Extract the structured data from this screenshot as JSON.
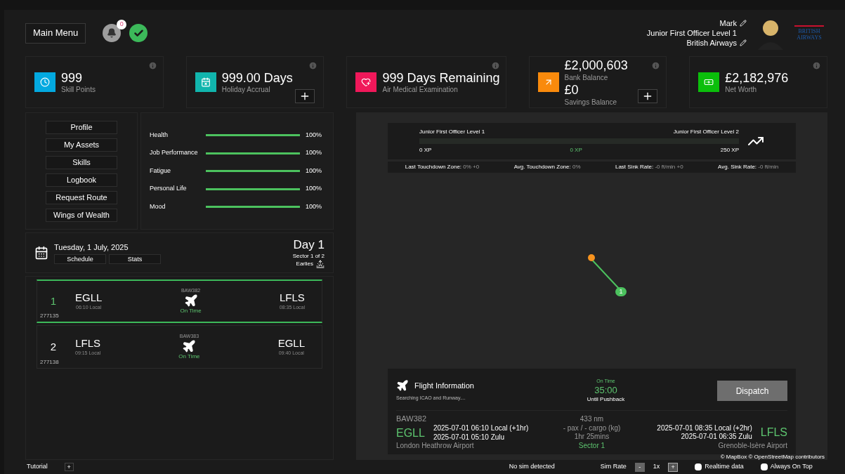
{
  "header": {
    "main_menu": "Main Menu",
    "notifications": "0",
    "status_ok": true,
    "user": {
      "name": "Mark",
      "rank": "Junior First Officer Level 1",
      "airline": "British Airways"
    },
    "logo_text": "BRITISH AIRWAYS"
  },
  "stat_cards": [
    {
      "kind": "clock",
      "color": "#03a9e0",
      "value": "999",
      "label": "Skill Points",
      "add": false
    },
    {
      "kind": "calendar",
      "color": "#11b5ad",
      "value": "999.00 Days",
      "label": "Holiday Accrual",
      "add": true
    },
    {
      "kind": "heart",
      "color": "#f0185a",
      "value": "999 Days Remaining",
      "label": "Air Medical Examination",
      "add": false
    },
    {
      "kind": "bank",
      "color": "#f98a0c",
      "value": "£2,000,603",
      "label": "Bank Balance",
      "value2": "£0",
      "label2": "Savings Balance",
      "add": true
    },
    {
      "kind": "money",
      "color": "#0bbf0b",
      "value": "£2,182,976",
      "label": "Net Worth",
      "add": false
    }
  ],
  "menu": [
    "Profile",
    "My Assets",
    "Skills",
    "Logbook",
    "Request Route",
    "Wings of Wealth"
  ],
  "wellbeing": [
    {
      "name": "Health",
      "level": 1,
      "reading": "100%"
    },
    {
      "name": "Job Performance",
      "level": 1,
      "reading": "100%"
    },
    {
      "name": "Fatigue",
      "level": 1,
      "reading": "100%"
    },
    {
      "name": "Personal Life",
      "level": 1,
      "reading": "100%"
    },
    {
      "name": "Mood",
      "level": 1,
      "reading": "100%"
    }
  ],
  "day": {
    "date": "Tuesday, 1 July, 2025",
    "tabs": [
      "Schedule",
      "Stats"
    ],
    "day": "Day 1",
    "sector": "Sector 1 of 2",
    "shift": "Earlies"
  },
  "flights": [
    {
      "number": "1",
      "code": "277135",
      "callsign": "BAW382",
      "from": "EGLL",
      "from_time": "06:10 Local",
      "to": "LFLS",
      "to_time": "08:35 Local",
      "status": "On Time",
      "selected": true
    },
    {
      "number": "2",
      "code": "277138",
      "callsign": "BAW383",
      "from": "LFLS",
      "from_time": "09:15 Local",
      "to": "EGLL",
      "to_time": "09:40 Local",
      "status": "On Time",
      "selected": false
    }
  ],
  "xp": {
    "current_rank": "Junior First Officer Level 1",
    "next_rank": "Junior First Officer Level 2",
    "level": 0,
    "min": "0 XP",
    "current": "0 XP",
    "max": "250 XP"
  },
  "landing_stats": [
    {
      "label": "Last Touchdown Zone:",
      "value": "0% +0"
    },
    {
      "label": "Avg. Touchdown Zone:",
      "value": "0%"
    },
    {
      "label": "Last Sink Rate:",
      "value": "-0 ft/min +0"
    },
    {
      "label": "Avg. Sink Rate:",
      "value": "-0 ft/min"
    }
  ],
  "map": {
    "route_marker": "1",
    "attribution": "© MapBox © OpenStreetMap contributors"
  },
  "flight_info": {
    "title": "Flight Information",
    "subtitle": "Searching ICAO and Runway....",
    "status": "On Time",
    "countdown": "35:00",
    "countdown_label": "Until Pushback",
    "dispatch": "Dispatch",
    "callsign": "BAW382",
    "from": "EGLL",
    "from_local": "2025-07-01 06:10 Local (+1hr)",
    "from_zulu": "2025-07-01 05:10 Zulu",
    "from_name": "London Heathrow Airport",
    "distance": "433 nm",
    "load": "- pax / - cargo (kg)",
    "duration": "1hr 25mins",
    "sector": "Sector 1",
    "to": "LFLS",
    "to_local": "2025-07-01 08:35 Local (+2hr)",
    "to_zulu": "2025-07-01 06:35 Zulu",
    "to_name": "Grenoble-Isère Airport"
  },
  "footer": {
    "tutorial": "Tutorial",
    "tutorial_add": "+",
    "sim_status": "No sim detected",
    "sim_rate_label": "Sim Rate",
    "minus": "-",
    "sim_rate": "1x",
    "plus": "+",
    "options": [
      {
        "label": "Realtime data",
        "checked": false
      },
      {
        "label": "Always On Top",
        "checked": false
      }
    ]
  }
}
